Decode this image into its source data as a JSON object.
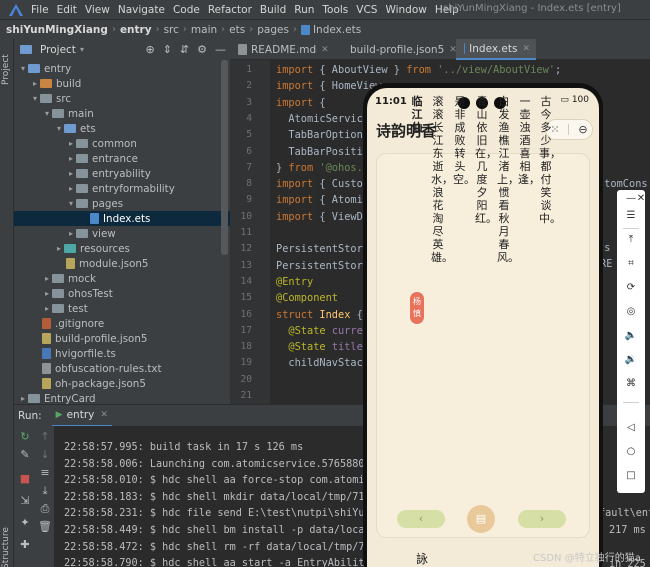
{
  "menu": {
    "items": [
      "File",
      "Edit",
      "View",
      "Navigate",
      "Code",
      "Refactor",
      "Build",
      "Run",
      "Tools",
      "VCS",
      "Window",
      "Help"
    ],
    "window_title": "shiYunMingXiang - Index.ets [entry]"
  },
  "breadcrumb": [
    "shiYunMingXiang",
    "entry",
    "src",
    "main",
    "ets",
    "pages",
    "Index.ets"
  ],
  "left_strip": {
    "project_label": "Project",
    "structure_label": "Structure"
  },
  "project_panel": {
    "title": "Project",
    "tree": [
      {
        "label": "entry",
        "depth": 1,
        "arrow": "▾",
        "icon": "folder-blue"
      },
      {
        "label": "build",
        "depth": 2,
        "arrow": "▸",
        "icon": "folder-orange"
      },
      {
        "label": "src",
        "depth": 2,
        "arrow": "▾",
        "icon": "folder"
      },
      {
        "label": "main",
        "depth": 3,
        "arrow": "▾",
        "icon": "folder"
      },
      {
        "label": "ets",
        "depth": 4,
        "arrow": "▾",
        "icon": "folder-blue"
      },
      {
        "label": "common",
        "depth": 5,
        "arrow": "▸",
        "icon": "folder"
      },
      {
        "label": "entrance",
        "depth": 5,
        "arrow": "▸",
        "icon": "folder"
      },
      {
        "label": "entryability",
        "depth": 5,
        "arrow": "▸",
        "icon": "folder"
      },
      {
        "label": "entryformability",
        "depth": 5,
        "arrow": "▸",
        "icon": "folder"
      },
      {
        "label": "pages",
        "depth": 5,
        "arrow": "▾",
        "icon": "folder"
      },
      {
        "label": "Index.ets",
        "depth": 6,
        "arrow": "",
        "icon": "file-ets",
        "selected": true
      },
      {
        "label": "view",
        "depth": 5,
        "arrow": "▸",
        "icon": "folder"
      },
      {
        "label": "resources",
        "depth": 4,
        "arrow": "▸",
        "icon": "folder-teal"
      },
      {
        "label": "module.json5",
        "depth": 4,
        "arrow": "",
        "icon": "file-json"
      },
      {
        "label": "mock",
        "depth": 3,
        "arrow": "▸",
        "icon": "folder"
      },
      {
        "label": "ohosTest",
        "depth": 3,
        "arrow": "▸",
        "icon": "folder"
      },
      {
        "label": "test",
        "depth": 3,
        "arrow": "▸",
        "icon": "folder"
      },
      {
        "label": ".gitignore",
        "depth": 2,
        "arrow": "",
        "icon": "file-git"
      },
      {
        "label": "build-profile.json5",
        "depth": 2,
        "arrow": "",
        "icon": "file-json"
      },
      {
        "label": "hvigorfile.ts",
        "depth": 2,
        "arrow": "",
        "icon": "file-ts"
      },
      {
        "label": "obfuscation-rules.txt",
        "depth": 2,
        "arrow": "",
        "icon": "file-txt"
      },
      {
        "label": "oh-package.json5",
        "depth": 2,
        "arrow": "",
        "icon": "file-json"
      },
      {
        "label": "EntryCard",
        "depth": 1,
        "arrow": "▸",
        "icon": "folder"
      },
      {
        "label": "hvigor",
        "depth": 1,
        "arrow": "▸",
        "icon": "folder"
      }
    ]
  },
  "editor": {
    "tabs": [
      {
        "label": "README.md"
      },
      {
        "label": "build-profile.json5"
      },
      {
        "label": "Index.ets",
        "active": true
      }
    ],
    "lines": [
      {
        "n": "1",
        "html": "<span class=\"kw\">import</span> { AboutView } <span class=\"kw\">from</span> <span class=\"str\">'../view/AboutView'</span>;"
      },
      {
        "n": "2",
        "html": "<span class=\"kw\">import</span> { HomeView"
      },
      {
        "n": "3",
        "html": "<span class=\"kw\">import</span> {"
      },
      {
        "n": "4",
        "html": "  AtomicService"
      },
      {
        "n": "5",
        "html": "  TabBarOptions"
      },
      {
        "n": "6",
        "html": "  TabBarPositio"
      },
      {
        "n": "7",
        "html": "} <span class=\"kw\">from</span> <span class=\"str\">'@ohos.a</span>"
      },
      {
        "n": "8",
        "html": "<span class=\"kw\">import</span> { Custom"
      },
      {
        "n": "9",
        "html": "<span class=\"kw\">import</span> { Atomic"
      },
      {
        "n": "10",
        "html": "<span class=\"kw\">import</span> { ViewDa"
      },
      {
        "n": "11",
        "html": ""
      },
      {
        "n": "12",
        "html": "PersistentStora"
      },
      {
        "n": "13",
        "html": "PersistentStora"
      },
      {
        "n": "14",
        "html": "<span class=\"an\">@Entry</span>"
      },
      {
        "n": "15",
        "html": "<span class=\"an\">@Component</span>"
      },
      {
        "n": "16",
        "html": "<span class=\"kw\">struct</span> <span class=\"fn\">Index</span> {"
      },
      {
        "n": "17",
        "html": "  <span class=\"an\">@State</span> <span class=\"pur\">curren</span>"
      },
      {
        "n": "18",
        "html": "  <span class=\"an\">@State</span> <span class=\"pur\">title</span>"
      },
      {
        "n": "19",
        "html": "  childNavStack"
      },
      {
        "n": "20",
        "html": ""
      },
      {
        "n": "21",
        "html": ""
      }
    ],
    "right_fragments": [
      "stomCons",
      "rv",
      "ts",
      "RE",
      "S"
    ]
  },
  "run_panel": {
    "label": "Run:",
    "tab": "entry",
    "console": [
      "22:58:57.995: build task in 17 s 126 ms",
      "22:58:58.006: Launching com.atomicservice.57658802",
      "22:58:58.010: $ hdc shell aa force-stop com.atomic",
      "22:58:58.183: $ hdc shell mkdir data/local/tmp/71d",
      "22:58:58.231: $ hdc file send E:\\test\\nutpi\\shiYun",
      "22:58:58.449: $ hdc shell bm install -p data/local",
      "22:58:58.472: $ hdc shell rm -rf data/local/tmp/71",
      "22:58:58.790: $ hdc shell aa start -a EntryAbility"
    ],
    "console_right": [
      "fault\\ent",
      "217 ms",
      "",
      "in 225"
    ]
  },
  "phone": {
    "time": "11:01",
    "battery": "100",
    "app_title": "诗韵明香",
    "poem": {
      "title": "临江仙",
      "author": "杨慎",
      "columns": [
        "古今多少事，都付笑谈中。",
        "一壶浊酒喜相逢，",
        "白发渔樵江渚上，惯看秋月春风。",
        "青山依旧在，几度夕阳红。",
        "是非成败转头空。",
        "滚滚长江东逝水，浪花淘尽英雄。"
      ]
    },
    "nav_prev": "‹",
    "nav_next": "›"
  },
  "watermark": "CSDN @特立独行的猫a"
}
